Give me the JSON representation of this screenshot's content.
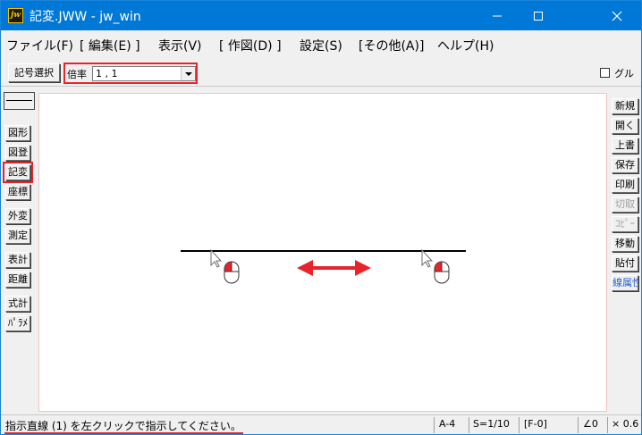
{
  "window": {
    "title": "記変.JWW - jw_win",
    "app_icon_text": "jw"
  },
  "menu": [
    "ファイル(F)",
    "[ 編集(E) ]",
    "表示(V)",
    "[ 作図(D) ]",
    "設定(S)",
    "[その他(A)]",
    "ヘルプ(H)"
  ],
  "toolbar": {
    "kigou_button": "記号選択",
    "scale_label": "倍率",
    "scale_value": "1 , 1",
    "group_label": "グル"
  },
  "left_tools": [
    "図形",
    "図登",
    "記変",
    "座標",
    "外変",
    "測定",
    "表計",
    "距離",
    "式計",
    "ﾊﾟﾗﾒ"
  ],
  "left_active": "記変",
  "right_tools": [
    "新規",
    "開く",
    "上書",
    "保存",
    "印刷",
    "切取",
    "ｺﾋﾟｰ",
    "移動",
    "貼付",
    "線属性"
  ],
  "right_disabled": [
    "切取",
    "ｺﾋﾟｰ"
  ],
  "colors": {
    "titlebar": "#0078d7",
    "highlight": "#e8232a",
    "arrow": "#e8232a",
    "line": "#000000"
  },
  "icons": [
    "minimize-icon",
    "maximize-icon",
    "close-icon",
    "cursor-arrow-icon",
    "mouse-left-click-icon",
    "double-arrow-icon"
  ],
  "status": {
    "message": "指示直線 (1) を左クリックで指示してください。",
    "paper": "A-4",
    "scale": "S=1/10",
    "layer": "[F-0]",
    "angle": "∠0",
    "zoom": "× 0.6"
  }
}
